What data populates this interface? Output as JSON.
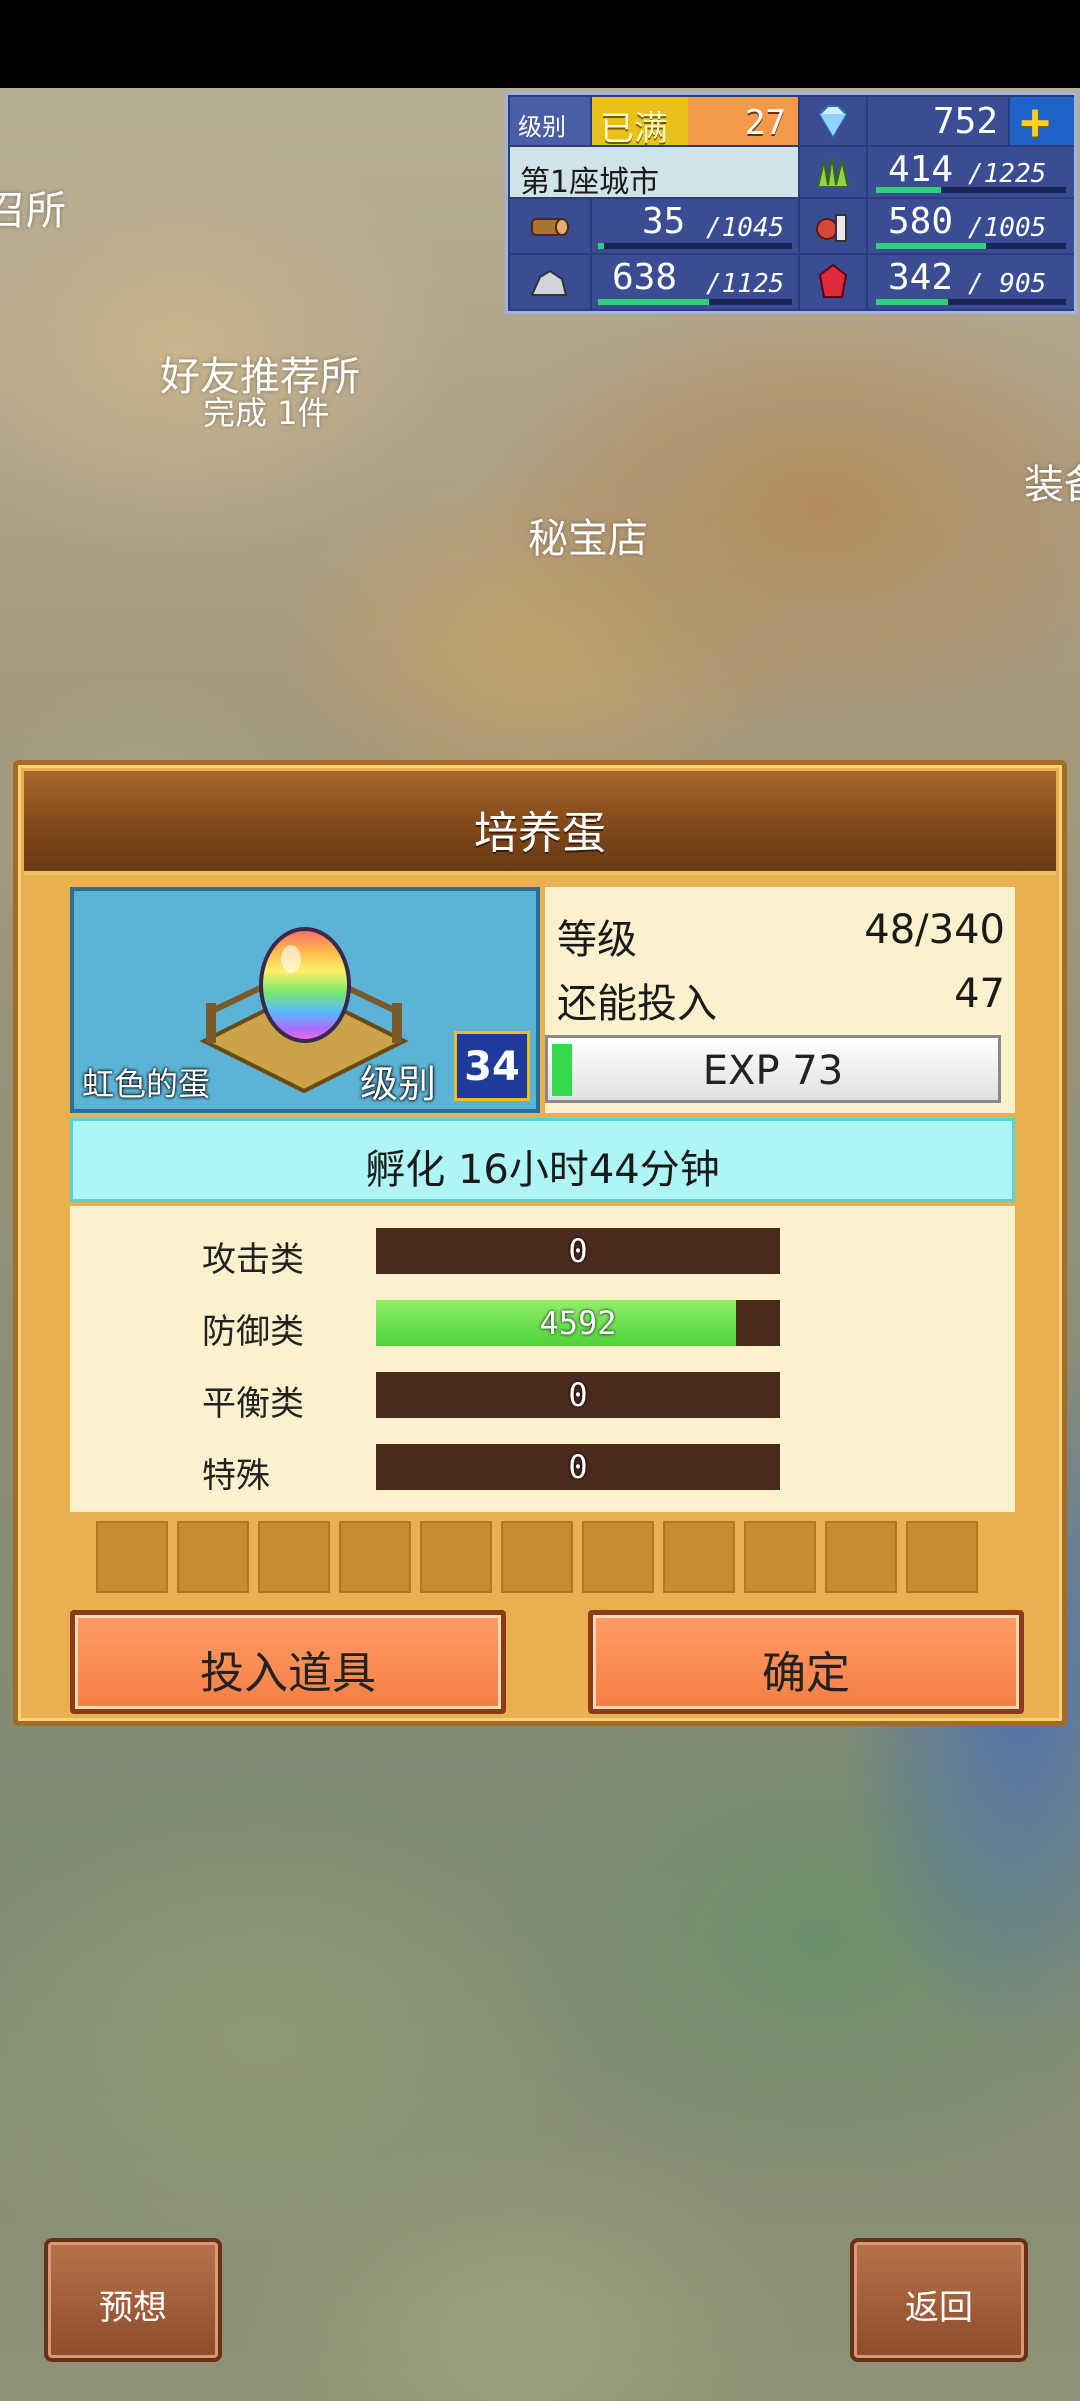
{
  "map": {
    "labels": [
      "召所",
      "好友推荐所",
      "完成 1件",
      "秘宝店",
      "装备"
    ]
  },
  "stats": {
    "rank_label": "级别",
    "rank_badge": "已满",
    "rank_value": "27",
    "gems": "752",
    "plus_icon": "+",
    "city": "第1座城市",
    "resources": [
      {
        "icon": "grass-icon",
        "value": "414",
        "max": "/1225",
        "level": 0.34
      },
      {
        "icon": "wood-log-icon",
        "value": "35",
        "max": "/1045",
        "level": 0.03
      },
      {
        "icon": "food-icon",
        "value": "580",
        "max": "/1005",
        "level": 0.58
      },
      {
        "icon": "ore-icon",
        "value": "638",
        "max": "/1125",
        "level": 0.57
      },
      {
        "icon": "ruby-icon",
        "value": "342",
        "max": "/ 905",
        "level": 0.38
      }
    ]
  },
  "dialog": {
    "title": "培养蛋",
    "egg_name": "虹色的蛋",
    "egg_rank_label": "级别",
    "egg_rank": "34",
    "level_label": "等级",
    "level_value": "48/340",
    "invest_label": "还能投入",
    "invest_value": "47",
    "exp_label": "EXP 73",
    "exp_progress": 0.04,
    "hatch_text": "孵化 16小时44分钟",
    "attributes": [
      {
        "label": "攻击类",
        "value": "0",
        "fill": 0
      },
      {
        "label": "防御类",
        "value": "4592",
        "fill": 0.89
      },
      {
        "label": "平衡类",
        "value": "0",
        "fill": 0
      },
      {
        "label": "特殊",
        "value": "0",
        "fill": 0
      }
    ],
    "slot_count": 11,
    "btn_items": "投入道具",
    "btn_confirm": "确定"
  },
  "bottom": {
    "btn_left": "预想",
    "btn_right": "返回"
  },
  "colors": {
    "panel_blue": "#2d3c7a",
    "dialog_gold": "#e8b04e",
    "button_orange": "#f47e44",
    "hatch_cyan": "#aef5f5",
    "attr_green": "#4fd23a"
  }
}
